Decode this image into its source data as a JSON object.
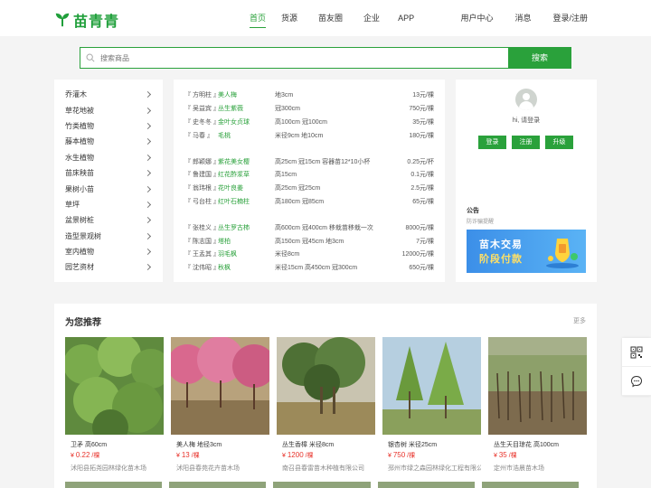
{
  "brand": {
    "name": "苗青青",
    "color": "#1f9f3a"
  },
  "nav": {
    "items": [
      "首页",
      "货源",
      "苗友圈",
      "企业",
      "APP"
    ],
    "active_index": 0,
    "right": [
      "用户中心",
      "消息",
      "登录/注册"
    ]
  },
  "search": {
    "placeholder": "搜索商品",
    "button": "搜索"
  },
  "categories": [
    "乔灌木",
    "草花地被",
    "竹类植物",
    "藤本植物",
    "水生植物",
    "苗床秧苗",
    "果树小苗",
    "草坪",
    "盆景树桩",
    "造型景观树",
    "室内植物",
    "园艺资材"
  ],
  "listings": [
    [
      {
        "who": "『 方明柱 』",
        "name": "美人梅",
        "spec": "地3cm",
        "price": "13元/棵"
      },
      {
        "who": "『 吴益宾 』",
        "name": "丛生紫薇",
        "spec": "冠300cm",
        "price": "750元/棵"
      },
      {
        "who": "『 史冬冬 』",
        "name": "金叶女贞球",
        "spec": "高100cm 冠100cm",
        "price": "35元/棵"
      },
      {
        "who": "『 马春 』",
        "name": "毛桃",
        "spec": "米径9cm 地10cm",
        "price": "180元/棵"
      }
    ],
    [
      {
        "who": "『 郎颖娜 』",
        "name": "紫花美女樱",
        "spec": "高25cm 冠15cm 容器苗12*10小杯",
        "price": "0.25元/杯"
      },
      {
        "who": "『 鲁建国 』",
        "name": "红花酢浆草",
        "spec": "高15cm",
        "price": "0.1元/棵"
      },
      {
        "who": "『 翁玮根 』",
        "name": "花叶良姜",
        "spec": "高25cm 冠25cm",
        "price": "2.5元/棵"
      },
      {
        "who": "『 弓台柱 』",
        "name": "红叶石楠柱",
        "spec": "高180cm 冠85cm",
        "price": "65元/棵"
      }
    ],
    [
      {
        "who": "『 张桂义 』",
        "name": "丛生罗古柿",
        "spec": "高600cm 冠400cm 移栽苗移栽一次",
        "price": "8000元/棵"
      },
      {
        "who": "『 陈志国 』",
        "name": "塔柏",
        "spec": "高150cm 冠45cm 地3cm",
        "price": "7元/棵"
      },
      {
        "who": "『 王孟其 』",
        "name": "羽毛枫",
        "spec": "米径8cm",
        "price": "12000元/棵"
      },
      {
        "who": "『 沈伟昭 』",
        "name": "秋枫",
        "spec": "米径15cm 高450cm 冠300cm",
        "price": "650元/棵"
      }
    ]
  ],
  "user": {
    "greeting": "hi, 请登录",
    "buttons": [
      "登录",
      "注册",
      "升级"
    ],
    "notice_title": "公告",
    "notice_sub": "防诈骗提醒",
    "banner_line1": "苗木交易",
    "banner_line2": "阶段付款"
  },
  "recommend": {
    "title": "为您推荐",
    "more": "更多",
    "items": [
      {
        "name": "卫矛 高60cm",
        "price": "0.22",
        "unit": "/棵",
        "seller": "沭阳县拓尧园林绿化苗木场"
      },
      {
        "name": "美人梅 地径3cm",
        "price": "13",
        "unit": "/棵",
        "seller": "沭阳县春苑花卉苗木场"
      },
      {
        "name": "丛生香樟 米径8cm",
        "price": "1200",
        "unit": "/棵",
        "seller": "南召县春雷苗木种植有限公司"
      },
      {
        "name": "银杏树 米径25cm",
        "price": "750",
        "unit": "/棵",
        "seller": "邳州市绿之森园林绿化工程有限公司"
      },
      {
        "name": "丛生天目琼花 高100cm",
        "price": "35",
        "unit": "/棵",
        "seller": "定州市浩晨苗木场"
      }
    ]
  },
  "price_symbol": "¥",
  "accent_color": "#2aa13b",
  "side_icons": [
    "qrcode-icon",
    "chat-icon"
  ]
}
